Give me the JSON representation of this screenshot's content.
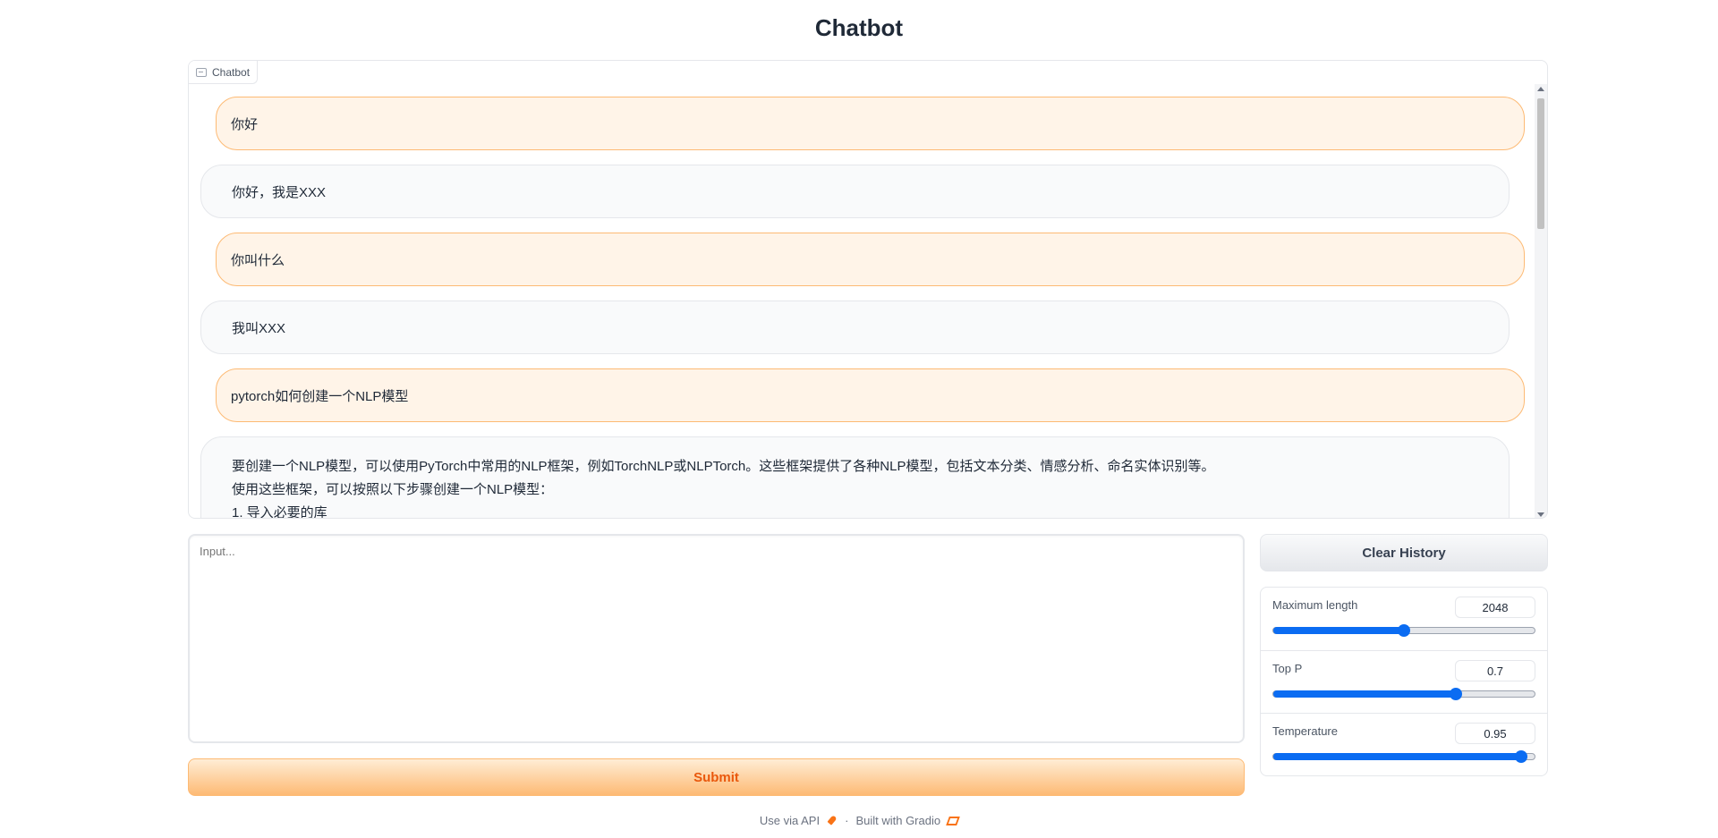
{
  "page": {
    "title": "Chatbot"
  },
  "chat": {
    "tag_label": "Chatbot",
    "messages": [
      {
        "role": "user",
        "text": "你好"
      },
      {
        "role": "bot",
        "text": "你好，我是XXX"
      },
      {
        "role": "user",
        "text": "你叫什么"
      },
      {
        "role": "bot",
        "text": "我叫XXX"
      },
      {
        "role": "user",
        "text": "pytorch如何创建一个NLP模型"
      },
      {
        "role": "bot",
        "lines": [
          "要创建一个NLP模型，可以使用PyTorch中常用的NLP框架，例如TorchNLP或NLPTorch。这些框架提供了各种NLP模型，包括文本分类、情感分析、命名实体识别等。",
          "使用这些框架，可以按照以下步骤创建一个NLP模型：",
          "1. 导入必要的库"
        ]
      }
    ]
  },
  "input": {
    "placeholder": "Input..."
  },
  "buttons": {
    "submit": "Submit",
    "clear": "Clear History"
  },
  "settings": {
    "max_length": {
      "label": "Maximum length",
      "value": "2048",
      "fraction": 0.5
    },
    "top_p": {
      "label": "Top P",
      "value": "0.7",
      "fraction": 0.7
    },
    "temperature": {
      "label": "Temperature",
      "value": "0.95",
      "fraction": 0.95
    }
  },
  "footer": {
    "api": "Use via API",
    "separator": "·",
    "built": "Built with Gradio"
  },
  "colors": {
    "accent": "#f97316",
    "slider": "#0b6cf2"
  }
}
